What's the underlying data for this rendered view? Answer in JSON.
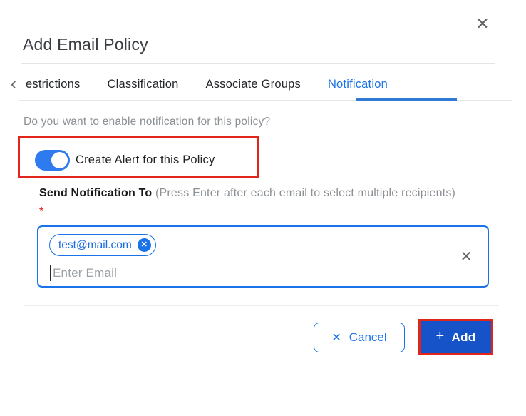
{
  "dialog": {
    "title": "Add Email Policy"
  },
  "icons": {
    "close": "✕",
    "back_chevron": "‹",
    "chip_remove": "✕",
    "clear_input": "✕",
    "cancel_x": "✕",
    "add_plus": "+"
  },
  "tabs": {
    "items": [
      {
        "label": "estrictions",
        "active": false
      },
      {
        "label": "Classification",
        "active": false
      },
      {
        "label": "Associate Groups",
        "active": false
      },
      {
        "label": "Notification",
        "active": true
      }
    ]
  },
  "notification_section": {
    "question": "Do you want to enable notification for this policy?",
    "toggle_label": "Create Alert for this Policy",
    "toggle_on": true
  },
  "recipients": {
    "label_bold": "Send Notification To",
    "label_hint": " (Press Enter after each email to select multiple recipients) ",
    "required_marker": "*",
    "chips": [
      {
        "email": "test@mail.com"
      }
    ],
    "input_placeholder": "Enter Email"
  },
  "footer": {
    "cancel_label": "Cancel",
    "add_label": "Add"
  },
  "colors": {
    "accent_blue": "#1a73e8",
    "toggle_blue": "#2e7bf0",
    "add_button_blue": "#1653c9",
    "tab_underline_blue": "#3079d4",
    "annotation_red": "#e1251b",
    "required_red": "#e53935",
    "text_dark": "#202226",
    "text_gray": "#8b9095",
    "placeholder_gray": "#9aa0a6"
  }
}
